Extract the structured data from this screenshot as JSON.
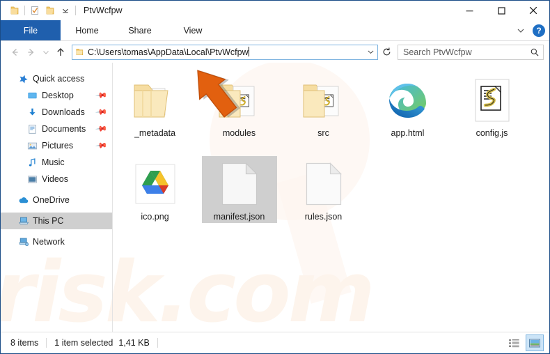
{
  "window": {
    "title": "PtvWcfpw",
    "quick_access_toolbar": [
      {
        "name": "folder-icon",
        "label": "Open folder"
      },
      {
        "name": "properties-icon",
        "label": "Properties"
      },
      {
        "name": "new-folder-icon",
        "label": "New folder"
      },
      {
        "name": "customize-dropdown-icon",
        "label": "Customize Quick Access Toolbar"
      }
    ],
    "controls": {
      "minimize": "─",
      "maximize": "☐",
      "close": "✕"
    }
  },
  "ribbon": {
    "tabs": [
      {
        "label": "File",
        "active": true
      },
      {
        "label": "Home",
        "active": false
      },
      {
        "label": "Share",
        "active": false
      },
      {
        "label": "View",
        "active": false
      }
    ],
    "collapse_icon": "chevron-down-icon",
    "help_label": "?"
  },
  "navbar": {
    "back_icon": "←",
    "forward_icon": "→",
    "recent_icon": "⌄",
    "up_icon": "↑",
    "address": {
      "value": "C:\\Users\\tomas\\AppData\\Local\\PtvWcfpw",
      "placeholder": "Address",
      "editing": true,
      "dropdown_icon": "⌄"
    },
    "refresh_icon": "↻",
    "search": {
      "placeholder": "Search PtvWcfpw",
      "value": "",
      "icon": "search-icon"
    }
  },
  "sidebar": {
    "items": [
      {
        "label": "Quick access",
        "icon": "star-icon",
        "level": 0,
        "pinned": false,
        "selected": false
      },
      {
        "label": "Desktop",
        "icon": "desktop-icon",
        "level": 1,
        "pinned": true,
        "selected": false
      },
      {
        "label": "Downloads",
        "icon": "downloads-icon",
        "level": 1,
        "pinned": true,
        "selected": false
      },
      {
        "label": "Documents",
        "icon": "documents-icon",
        "level": 1,
        "pinned": true,
        "selected": false
      },
      {
        "label": "Pictures",
        "icon": "pictures-icon",
        "level": 1,
        "pinned": true,
        "selected": false
      },
      {
        "label": "Music",
        "icon": "music-icon",
        "level": 1,
        "pinned": false,
        "selected": false
      },
      {
        "label": "Videos",
        "icon": "videos-icon",
        "level": 1,
        "pinned": false,
        "selected": false
      },
      {
        "label": "OneDrive",
        "icon": "onedrive-cloud-icon",
        "level": 0,
        "pinned": false,
        "selected": false
      },
      {
        "label": "This PC",
        "icon": "this-pc-icon",
        "level": 0,
        "pinned": false,
        "selected": true
      },
      {
        "label": "Network",
        "icon": "network-icon",
        "level": 0,
        "pinned": false,
        "selected": false
      }
    ]
  },
  "files": [
    {
      "name": "_metadata",
      "icon": "folder-with-documents-icon",
      "selected": false
    },
    {
      "name": "modules",
      "icon": "folder-with-script-icon",
      "selected": false
    },
    {
      "name": "src",
      "icon": "folder-with-script-icon",
      "selected": false
    },
    {
      "name": "app.html",
      "icon": "edge-browser-icon",
      "selected": false
    },
    {
      "name": "config.js",
      "icon": "javascript-file-icon",
      "selected": false
    },
    {
      "name": "ico.png",
      "icon": "google-drive-image-icon",
      "selected": false
    },
    {
      "name": "manifest.json",
      "icon": "blank-document-icon",
      "selected": true
    },
    {
      "name": "rules.json",
      "icon": "blank-document-icon",
      "selected": false
    }
  ],
  "statusbar": {
    "item_count": "8 items",
    "selection": "1 item selected",
    "selection_size": "1,41 KB",
    "views": [
      {
        "name": "details-view-button",
        "active": false
      },
      {
        "name": "large-icons-view-button",
        "active": true
      }
    ]
  },
  "watermark": {
    "text": "risk.com"
  },
  "colors": {
    "accent_blue": "#1f5fad",
    "window_border": "#1a4c87",
    "selection_grey": "#cfcfcf",
    "cursor_orange": "#e2600f",
    "folder_yellow": "#f7d98b"
  }
}
